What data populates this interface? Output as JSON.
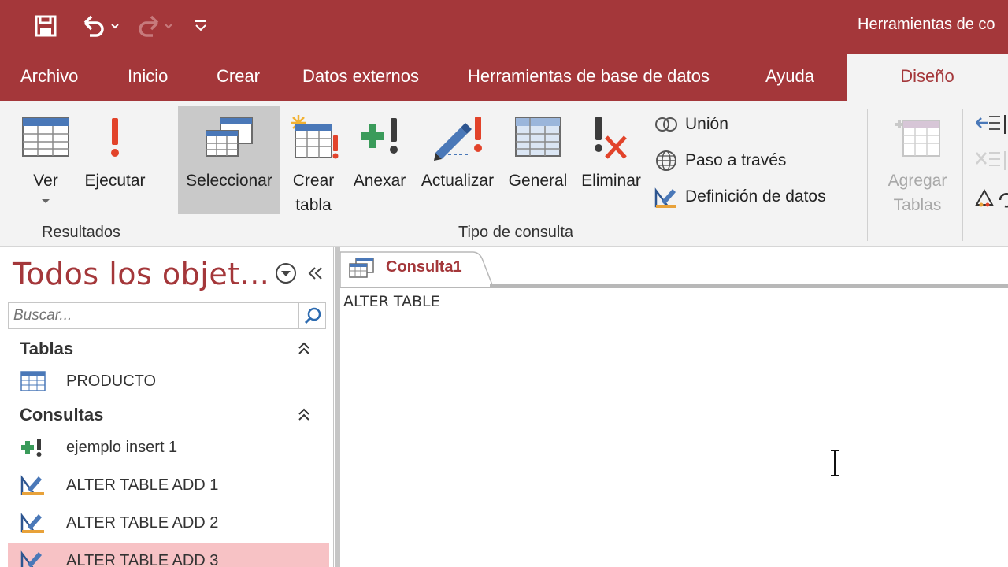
{
  "qat": {
    "save_icon": "save-icon",
    "undo_icon": "undo-icon",
    "redo_icon": "redo-icon",
    "customize_icon": "customize-qat-icon"
  },
  "context_title": "Herramientas de co",
  "menu": {
    "tabs": [
      "Archivo",
      "Inicio",
      "Crear",
      "Datos externos",
      "Herramientas de base de datos",
      "Ayuda"
    ],
    "active_tab": "Diseño"
  },
  "ribbon": {
    "ver": "Ver",
    "ejecutar": "Ejecutar",
    "resultados_group": "Resultados",
    "seleccionar": "Seleccionar",
    "crear_tabla": [
      "Crear",
      "tabla"
    ],
    "anexar": "Anexar",
    "actualizar": "Actualizar",
    "general": "General",
    "eliminar": "Eliminar",
    "union": "Unión",
    "paso_a_traves": "Paso a través",
    "definicion_datos": "Definición de datos",
    "tipo_consulta_group": "Tipo de consulta",
    "agregar_tablas": [
      "Agregar",
      "Tablas"
    ]
  },
  "nav": {
    "title": "Todos los objet...",
    "search_placeholder": "Buscar...",
    "sections": [
      {
        "title": "Tablas",
        "items": [
          {
            "label": "PRODUCTO",
            "icon": "table-icon"
          }
        ]
      },
      {
        "title": "Consultas",
        "items": [
          {
            "label": "ejemplo insert 1",
            "icon": "append-query-icon"
          },
          {
            "label": "ALTER TABLE ADD 1",
            "icon": "data-definition-query-icon"
          },
          {
            "label": "ALTER TABLE ADD 2",
            "icon": "data-definition-query-icon"
          },
          {
            "label": "ALTER TABLE ADD 3",
            "icon": "data-definition-query-icon"
          }
        ]
      }
    ]
  },
  "document": {
    "tab_label": "Consulta1",
    "sql_text": "ALTER TABLE"
  },
  "colors": {
    "accent": "#a4373a",
    "ribbon_bg": "#f3f3f3",
    "selected_item": "#f7c2c5"
  }
}
